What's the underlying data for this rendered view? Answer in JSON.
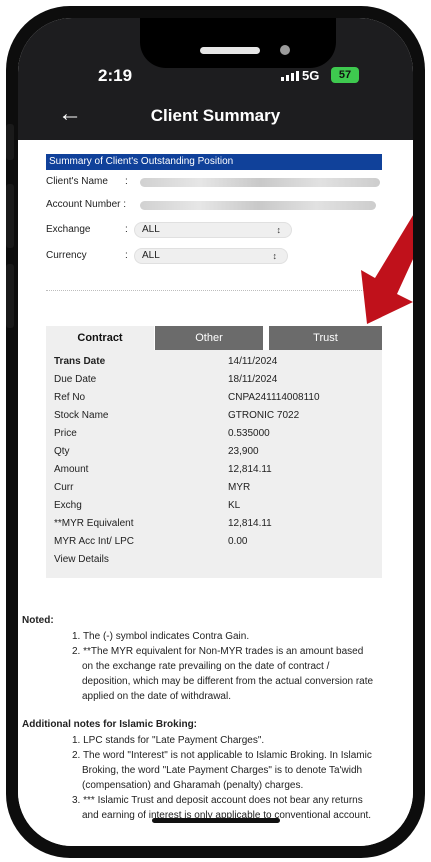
{
  "status_bar": {
    "time": "2:19",
    "network": "5G",
    "battery": "57"
  },
  "app_bar": {
    "back_icon": "arrow-left-icon",
    "title": "Client Summary"
  },
  "summary": {
    "header": "Summary of Client's Outstanding Position",
    "client_name_label": "Client's Name",
    "account_number_label": "Account Number :",
    "exchange_label": "Exchange",
    "exchange_value": "ALL",
    "currency_label": "Currency",
    "currency_value": "ALL",
    "colon": ":"
  },
  "tabs": [
    {
      "label": "Contract",
      "active": true
    },
    {
      "label": "Other",
      "active": false
    },
    {
      "label": "Trust",
      "active": false
    }
  ],
  "details": [
    {
      "label": "Trans Date",
      "value": "14/11/2024"
    },
    {
      "label": "Due Date",
      "value": "18/11/2024"
    },
    {
      "label": "Ref No",
      "value": "CNPA241114008110"
    },
    {
      "label": "Stock Name",
      "value": "GTRONIC 7022"
    },
    {
      "label": "Price",
      "value": "0.535000"
    },
    {
      "label": "Qty",
      "value": "23,900"
    },
    {
      "label": "Amount",
      "value": "12,814.11"
    },
    {
      "label": "Curr",
      "value": "MYR"
    },
    {
      "label": "Exchg",
      "value": "KL"
    },
    {
      "label": "**MYR Equivalent",
      "value": "12,814.11"
    },
    {
      "label": "MYR Acc Int/ LPC",
      "value": "0.00"
    },
    {
      "label": "View Details",
      "value": ""
    }
  ],
  "noted": {
    "title": "Noted:",
    "items": [
      "1. The (-) symbol indicates Contra Gain.",
      "2. **The MYR equivalent for Non-MYR trades is an amount based",
      "on the exchange rate prevailing on the date of contract /",
      "deposition, which may be different from the actual conversion rate",
      "applied on the date of withdrawal."
    ]
  },
  "islamic": {
    "title": "Additional notes for Islamic Broking:",
    "items": [
      "1. LPC stands for \"Late Payment Charges\".",
      "2. The word \"Interest\" is not applicable to Islamic Broking. In Islamic",
      "Broking, the word \"Late Payment Charges\" is to denote Ta'widh",
      "(compensation) and Gharamah (penalty) charges.",
      "3. *** Islamic Trust and deposit account does not bear any returns",
      "and earning of interest is only applicable to conventional account."
    ]
  },
  "colors": {
    "header_blue": "#10419a",
    "bar_dark": "#1d1d1f",
    "tab_inactive": "#6b6b6b",
    "arrow_red": "#c0111b",
    "battery_green": "#3ec94f"
  }
}
